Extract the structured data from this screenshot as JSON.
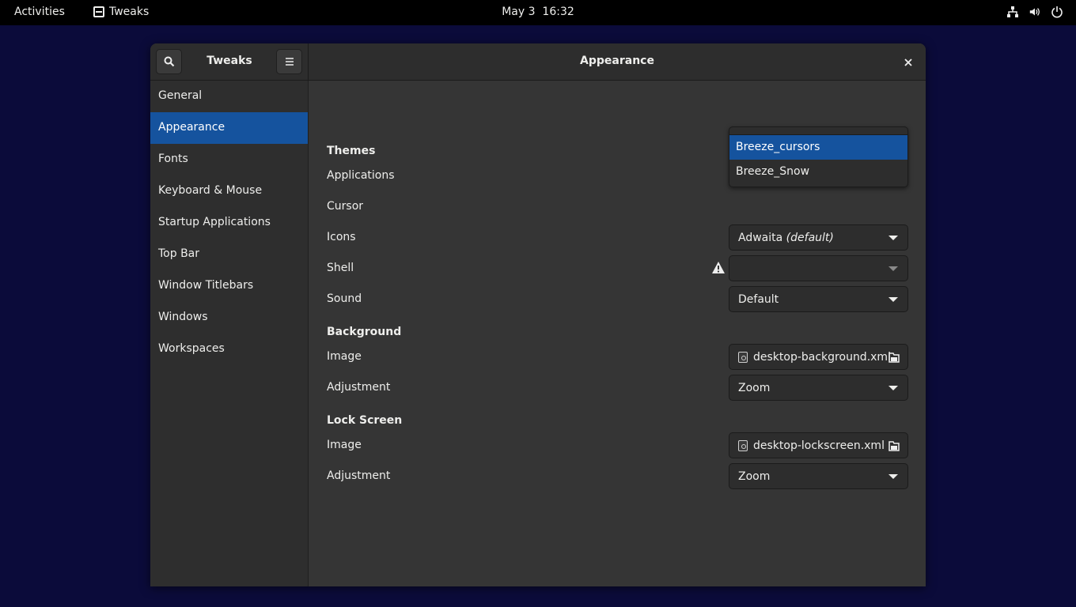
{
  "topbar": {
    "activities": "Activities",
    "app_name": "Tweaks",
    "date": "May 3",
    "time": "16:32"
  },
  "window": {
    "left_title": "Tweaks",
    "title": "Appearance"
  },
  "sidebar": {
    "items": [
      {
        "label": "General"
      },
      {
        "label": "Appearance",
        "selected": true
      },
      {
        "label": "Fonts"
      },
      {
        "label": "Keyboard & Mouse"
      },
      {
        "label": "Startup Applications"
      },
      {
        "label": "Top Bar"
      },
      {
        "label": "Window Titlebars"
      },
      {
        "label": "Windows"
      },
      {
        "label": "Workspaces"
      }
    ]
  },
  "themes": {
    "heading": "Themes",
    "applications_label": "Applications",
    "cursor_label": "Cursor",
    "icons_label": "Icons",
    "icons_value": "Adwaita",
    "icons_value_suffix": "(default)",
    "shell_label": "Shell",
    "shell_value": "",
    "sound_label": "Sound",
    "sound_value": "Default"
  },
  "cursor_popup": {
    "options": [
      "Breeze_cursors",
      "Breeze_Snow"
    ],
    "highlighted": "Breeze_cursors"
  },
  "background": {
    "heading": "Background",
    "image_label": "Image",
    "image_value": "desktop-background.xml",
    "adjustment_label": "Adjustment",
    "adjustment_value": "Zoom"
  },
  "lock_screen": {
    "heading": "Lock Screen",
    "image_label": "Image",
    "image_value": "desktop-lockscreen.xml",
    "adjustment_label": "Adjustment",
    "adjustment_value": "Zoom"
  },
  "colors": {
    "accent": "#15539e",
    "desktop": "#0b0b3a",
    "window_bg": "#353535",
    "sidebar_bg": "#2e2e2e"
  }
}
